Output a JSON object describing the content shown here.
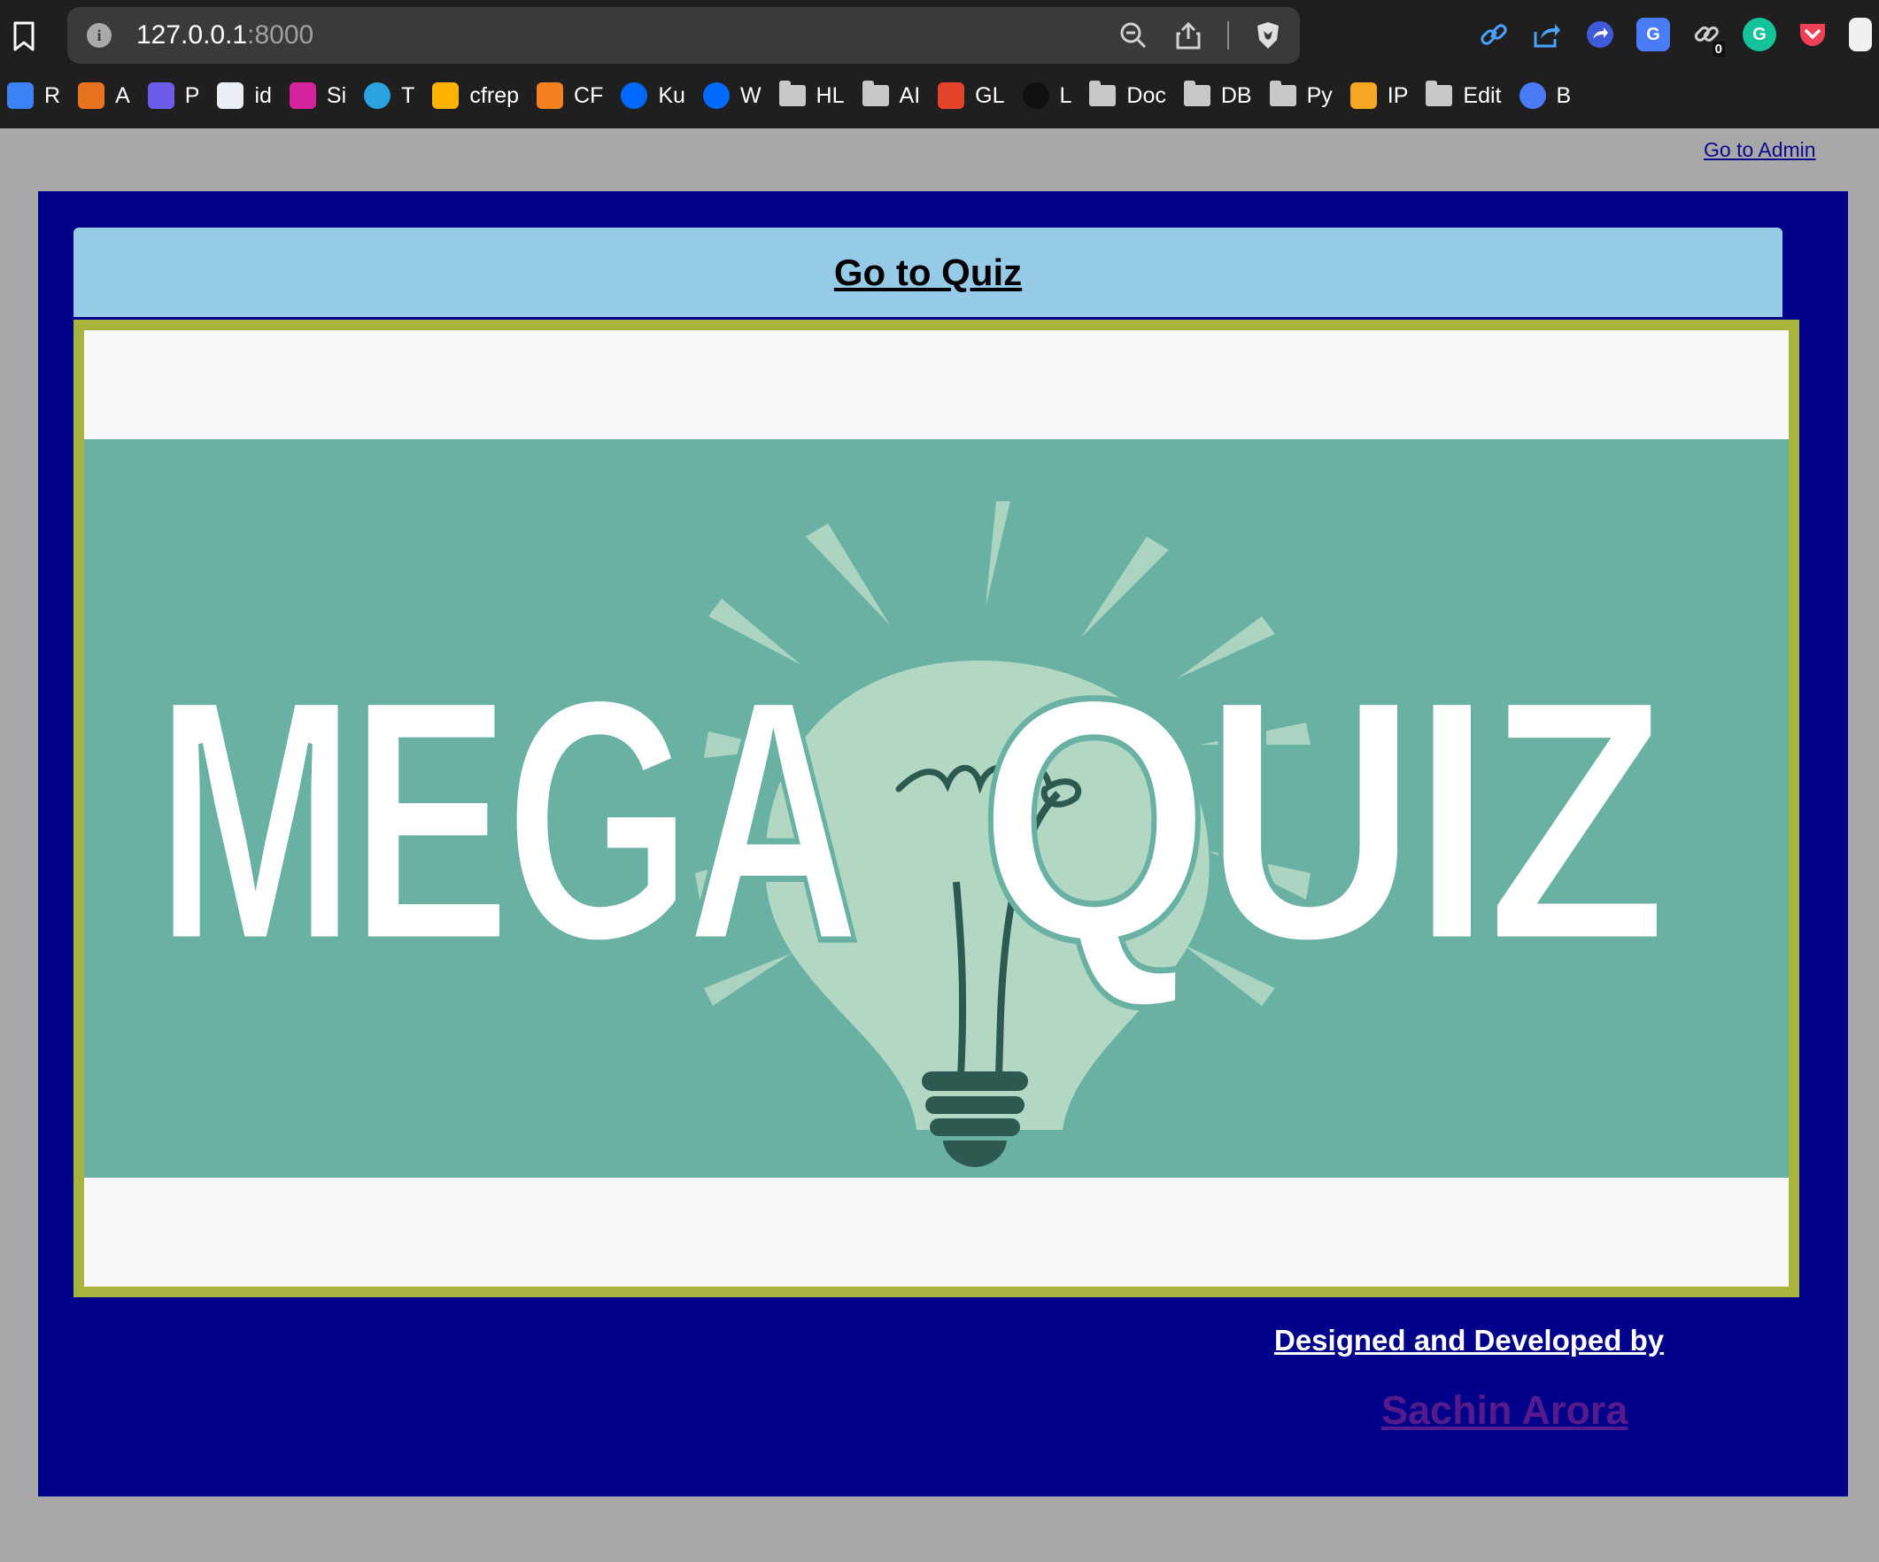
{
  "browser": {
    "url_host": "127.0.0.1",
    "url_port": ":8000",
    "extension_badge": "0",
    "bookmarks": [
      {
        "label": "R",
        "icon": "raycast-icon",
        "color": "#3b82f6"
      },
      {
        "label": "A",
        "icon": "app-icon",
        "color": "#e8731f"
      },
      {
        "label": "P",
        "icon": "list-icon",
        "color": "#6c5ce7"
      },
      {
        "label": "id",
        "icon": "id-card-icon",
        "color": "#e9eef5"
      },
      {
        "label": "Si",
        "icon": "instagram-icon",
        "color": "#d6249f"
      },
      {
        "label": "T",
        "icon": "telegram-icon",
        "color": "#2aa3e0"
      },
      {
        "label": "cfrep",
        "icon": "firebase-icon",
        "color": "#ffb300"
      },
      {
        "label": "CF",
        "icon": "cloudflare-icon",
        "color": "#f48120"
      },
      {
        "label": "Ku",
        "icon": "digitalocean-icon",
        "color": "#0069ff"
      },
      {
        "label": "W",
        "icon": "digitalocean-icon",
        "color": "#0069ff"
      },
      {
        "label": "HL",
        "icon": "folder-icon",
        "color": "#c8c8c8"
      },
      {
        "label": "AI",
        "icon": "folder-icon",
        "color": "#c8c8c8"
      },
      {
        "label": "GL",
        "icon": "gitlab-icon",
        "color": "#e24329"
      },
      {
        "label": "L",
        "icon": "tiktok-icon",
        "color": "#111111"
      },
      {
        "label": "Doc",
        "icon": "folder-icon",
        "color": "#c8c8c8"
      },
      {
        "label": "DB",
        "icon": "folder-icon",
        "color": "#c8c8c8"
      },
      {
        "label": "Py",
        "icon": "folder-icon",
        "color": "#c8c8c8"
      },
      {
        "label": "IP",
        "icon": "cube-icon",
        "color": "#f5a623"
      },
      {
        "label": "Edit",
        "icon": "folder-icon",
        "color": "#c8c8c8"
      },
      {
        "label": "B",
        "icon": "sparkle-icon",
        "color": "#4a7cf7"
      }
    ]
  },
  "page": {
    "admin_link": "Go to Admin",
    "quiz_link": "Go to Quiz",
    "hero": {
      "title_word_1": "MEGA",
      "title_word_2": "QUIZ",
      "image_name": "lightbulb-illustration"
    },
    "credit_label": "Designed and Developed by",
    "author_link": "Sachin Arora"
  },
  "colors": {
    "page_background": "#a8a8a8",
    "panel": "#00008b",
    "quiz_bar": "#96cbe8",
    "hero_border": "#a8b43c",
    "hero_band": "#68b1a3",
    "bulb": "#b2d8c4",
    "visited_link": "#551a8b"
  }
}
